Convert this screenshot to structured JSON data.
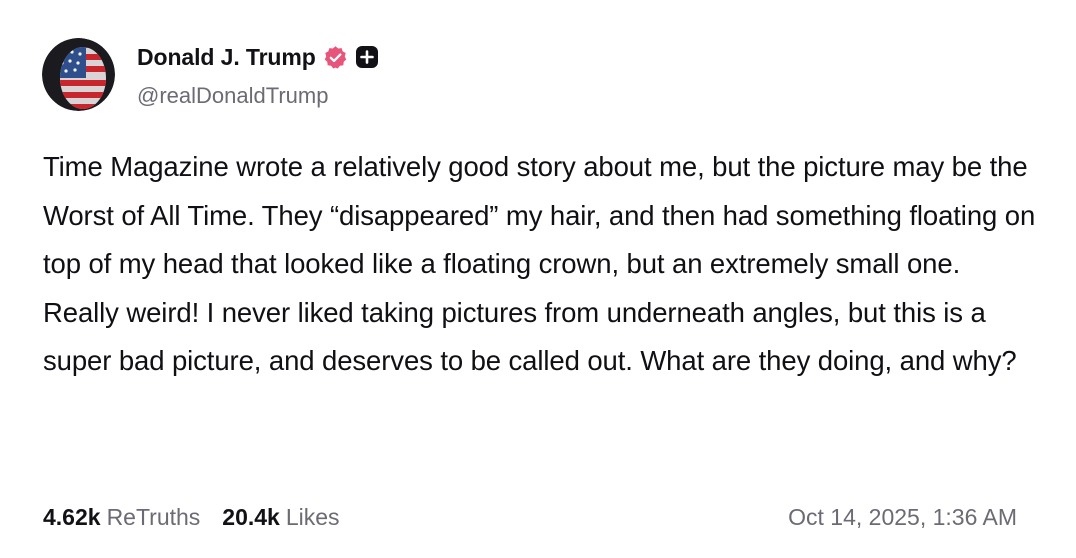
{
  "author": {
    "avatar_icon": "flag-face-avatar",
    "display_name": "Donald J. Trump",
    "verified_icon": "verified-badge-icon",
    "verified_color": "#e8557a",
    "plus_icon": "plus-badge-icon",
    "handle": "@realDonaldTrump"
  },
  "post": {
    "text": "Time Magazine wrote a relatively good story about me, but the picture may be the Worst of All Time. They “disappeared” my hair, and then had something floating on top of my head that looked like a floating crown, but an extremely small one. Really weird! I never liked taking pictures from underneath angles, but this is a super bad picture, and deserves to be called out. What are they doing, and why?"
  },
  "stats": {
    "retruths_count": "4.62k",
    "retruths_label": "ReTruths",
    "likes_count": "20.4k",
    "likes_label": "Likes",
    "timestamp": "Oct 14, 2025, 1:36 AM"
  }
}
